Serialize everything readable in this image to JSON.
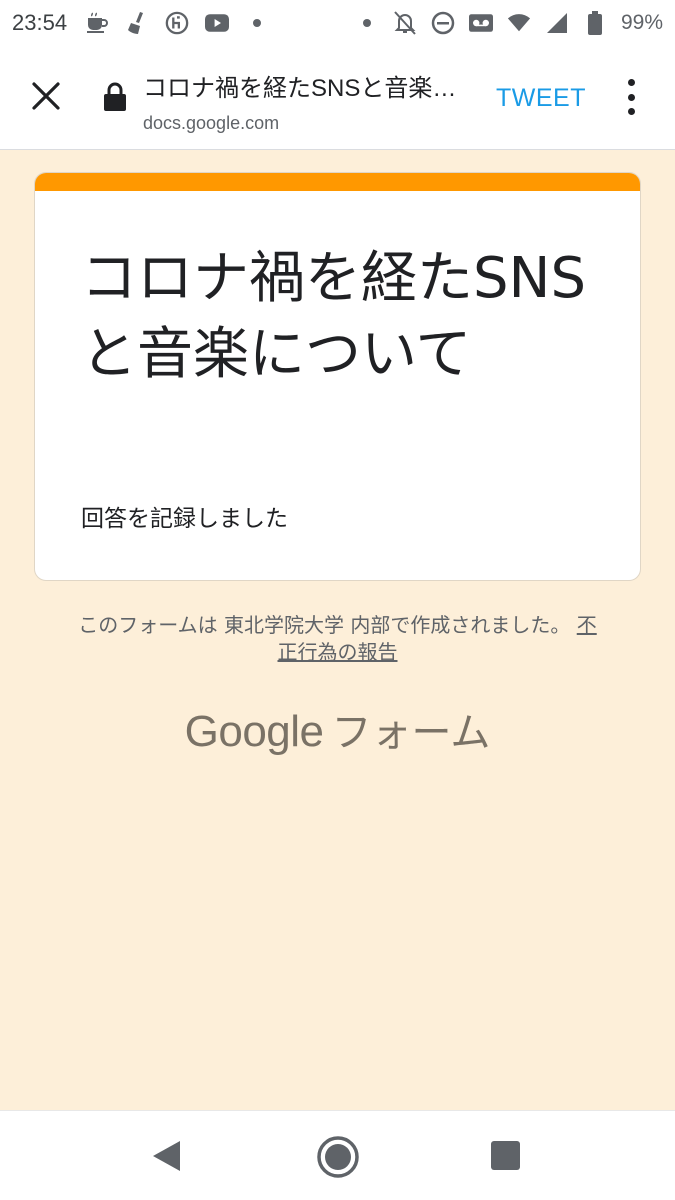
{
  "status_bar": {
    "time": "23:54",
    "battery": "99%",
    "icons_left": [
      "coffee-icon",
      "broom-icon",
      "hatena-icon",
      "youtube-icon",
      "dot-icon"
    ],
    "icons_right": [
      "dot-icon",
      "alarm-off-icon",
      "do-not-disturb-icon",
      "voicemail-icon",
      "wifi-icon",
      "signal-icon",
      "battery-icon"
    ]
  },
  "browser": {
    "title": "コロナ禍を経たSNSと音楽…",
    "url": "docs.google.com",
    "action_label": "TWEET",
    "accent_color": "#1a9be6"
  },
  "form": {
    "title": "コロナ禍を経たSNSと音楽について",
    "response_message": "回答を記録しました",
    "accent_color": "#ff9800"
  },
  "footer": {
    "note": "このフォームは 東北学院大学 内部で作成されました。",
    "report_link": "不正行為の報告",
    "logo_google": "Google",
    "logo_forms": "フォーム"
  },
  "nav_bar": {
    "buttons": [
      "back",
      "home",
      "recents"
    ]
  }
}
